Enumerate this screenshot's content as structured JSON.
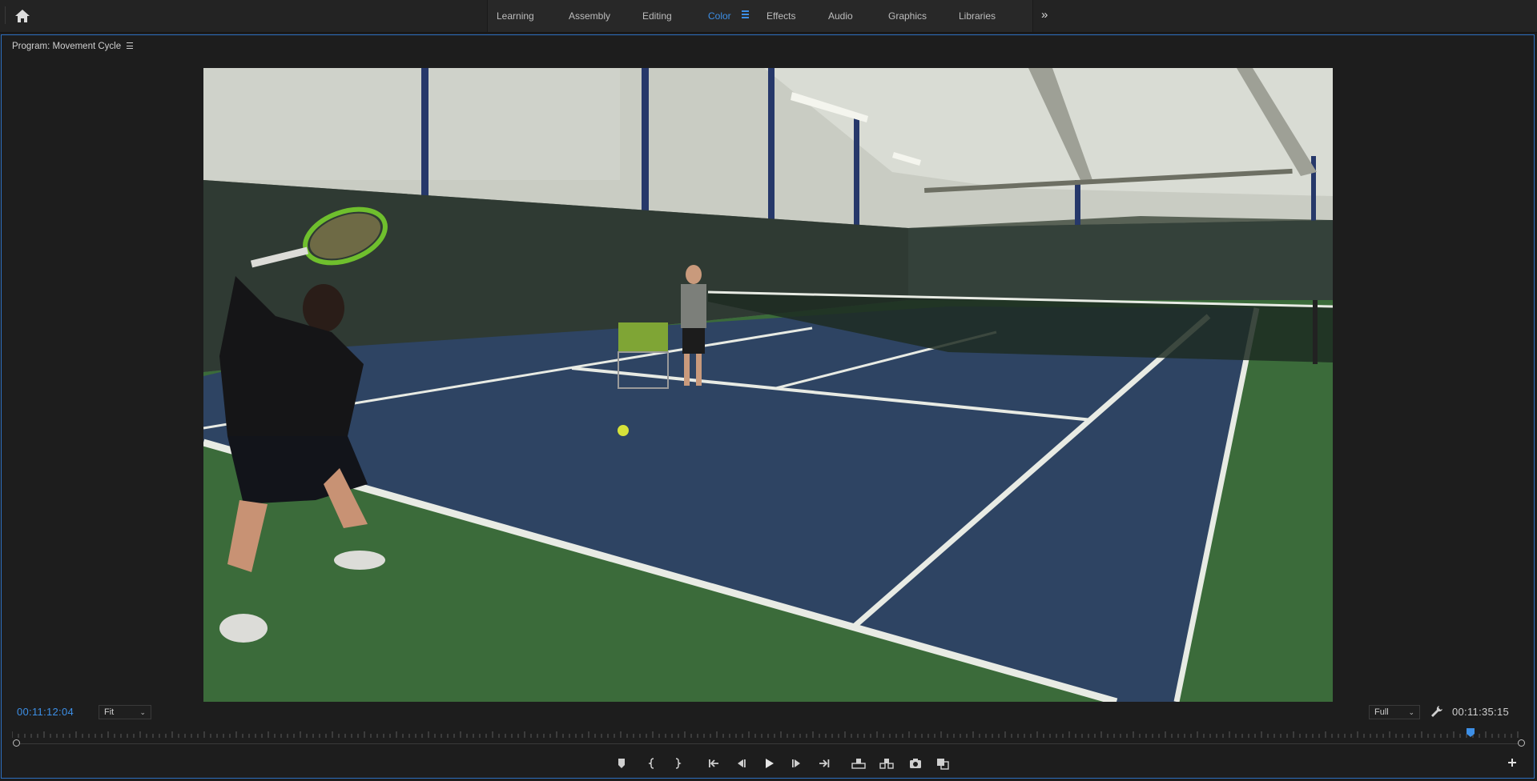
{
  "workspaces": {
    "tabs": [
      {
        "label": "Learning"
      },
      {
        "label": "Assembly"
      },
      {
        "label": "Editing"
      },
      {
        "label": "Color"
      },
      {
        "label": "Effects"
      },
      {
        "label": "Audio"
      },
      {
        "label": "Graphics"
      },
      {
        "label": "Libraries"
      }
    ],
    "active_tab": "Color",
    "overflow_label": "»"
  },
  "program_monitor": {
    "title": "Program: Movement Cycle",
    "current_timecode": "00:11:12:04",
    "zoom": {
      "selected": "Fit"
    },
    "resolution": {
      "selected": "Full"
    },
    "duration_timecode": "00:11:35:15"
  },
  "icons": {
    "home": "home-icon",
    "panel_menu": "hamburger-menu-icon",
    "settings": "wrench-icon",
    "add": "plus-icon",
    "transport": [
      "add-marker-icon",
      "mark-in-icon",
      "mark-out-icon",
      "go-to-in-icon",
      "step-back-icon",
      "play-icon",
      "step-forward-icon",
      "go-to-out-icon",
      "lift-icon",
      "extract-icon",
      "export-frame-icon",
      "comparison-view-icon"
    ]
  },
  "colors": {
    "accent": "#3d8fe6",
    "panel_border": "#2d6fbf",
    "background": "#1d1d1d"
  }
}
